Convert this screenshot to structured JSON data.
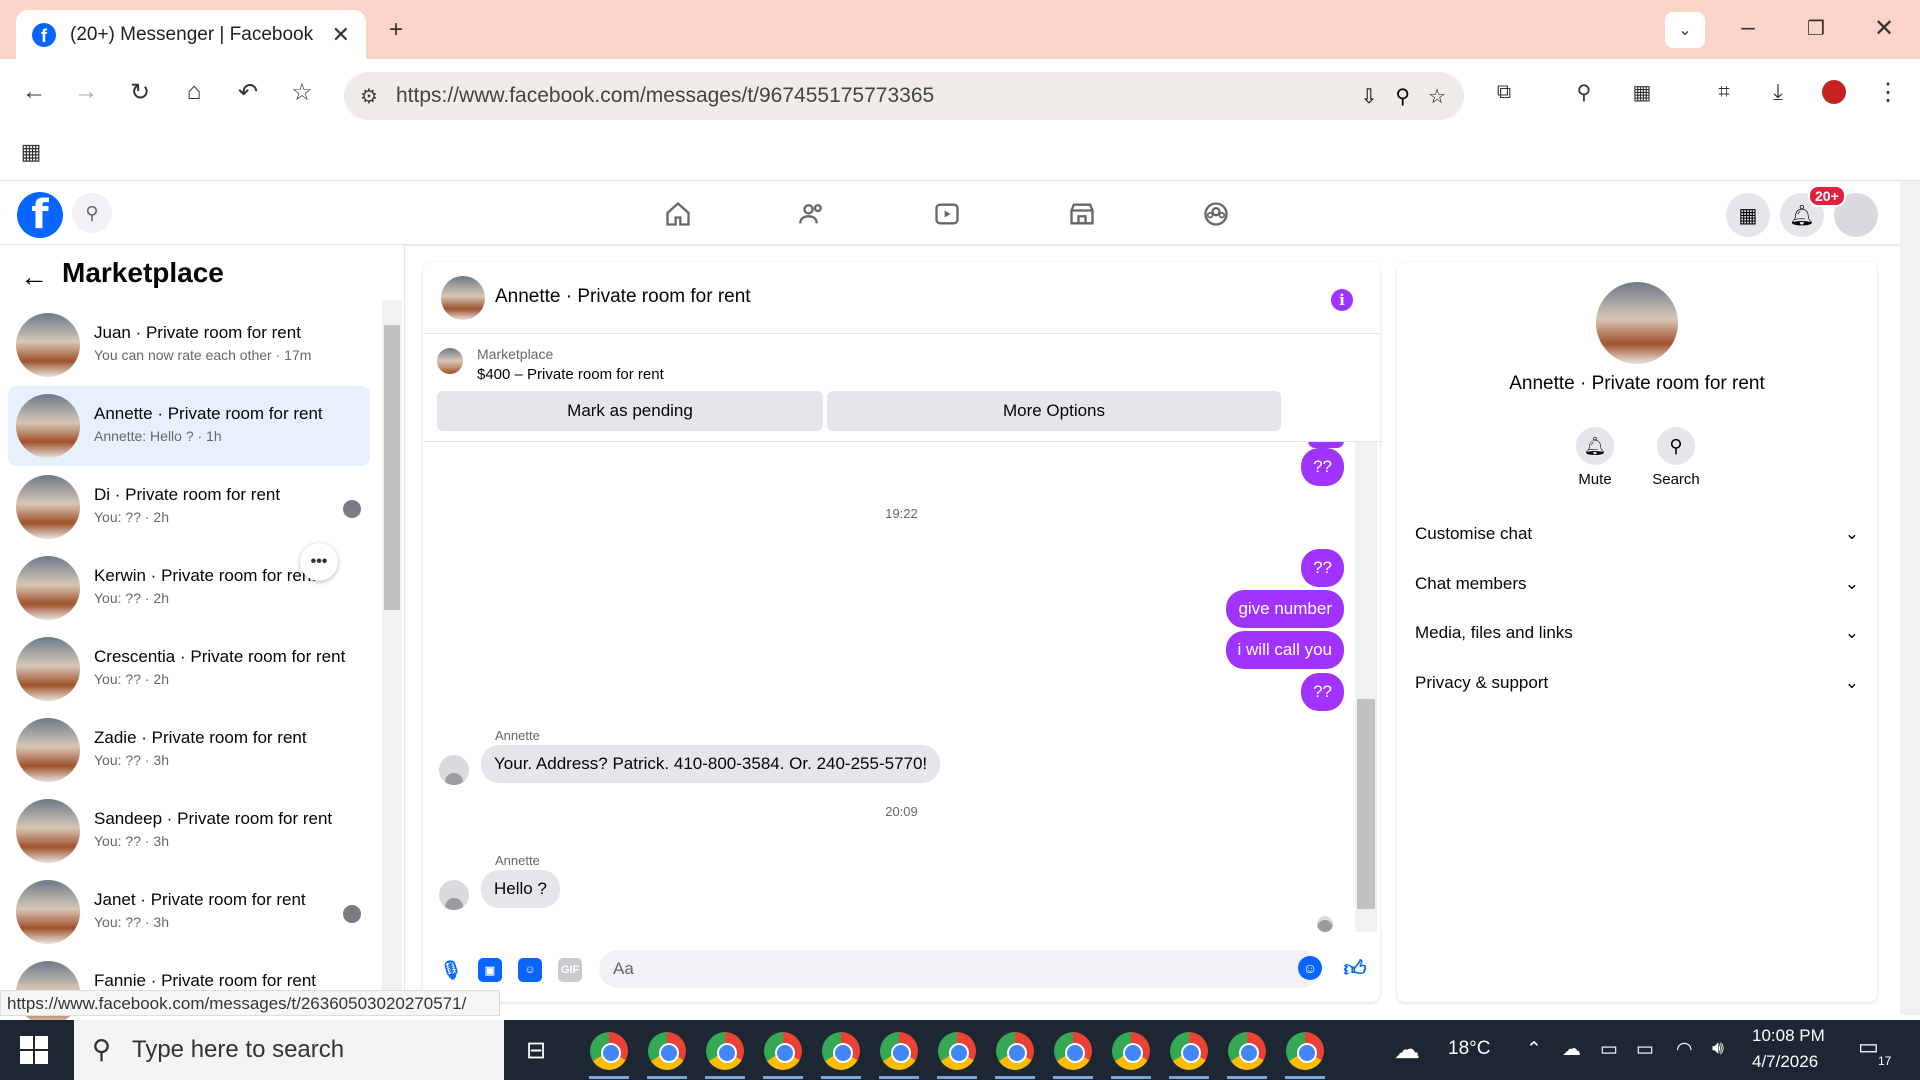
{
  "browser": {
    "tab_title": "(20+) Messenger | Facebook",
    "url": "https://www.facebook.com/messages/t/967455175773365"
  },
  "nav": {
    "notif_badge": "20+"
  },
  "left": {
    "title": "Marketplace",
    "conversations": [
      {
        "name": "Juan · Private room for rent",
        "snippet": "You can now rate each other · 17m"
      },
      {
        "name": "Annette · Private room for rent",
        "snippet": "Annette: Hello ? · 1h"
      },
      {
        "name": "Di · Private room for rent",
        "snippet": "You: ?? · 2h"
      },
      {
        "name": "Kerwin · Private room for rent",
        "snippet": "You: ?? · 2h"
      },
      {
        "name": "Crescentia · Private room for rent",
        "snippet": "You: ?? · 2h"
      },
      {
        "name": "Zadie · Private room for rent",
        "snippet": "You: ?? · 3h"
      },
      {
        "name": "Sandeep · Private room for rent",
        "snippet": "You: ?? · 3h"
      },
      {
        "name": "Janet · Private room for rent",
        "snippet": "You: ?? · 3h"
      },
      {
        "name": "Fannie · Private room for rent",
        "snippet": ""
      }
    ]
  },
  "chat": {
    "title": "Annette · Private room for rent",
    "marketplace_label": "Marketplace",
    "listing": "$400 – Private room for rent",
    "btn_pending": "Mark as pending",
    "btn_more": "More Options",
    "time1": "19:22",
    "out_msgs": [
      "??",
      "give number",
      "i will call you",
      "??"
    ],
    "top_msg": "??",
    "sender": "Annette",
    "in_msg1": "Your. Address?  Patrick. 410-800-3584. Or. 240-255-5770!",
    "time2": "20:09",
    "in_msg2": "Hello ?",
    "composer_placeholder": "Aa"
  },
  "right": {
    "name": "Annette · Private room for rent",
    "mute": "Mute",
    "search": "Search",
    "rows": [
      "Customise chat",
      "Chat members",
      "Media, files and links",
      "Privacy & support"
    ]
  },
  "status_url": "https://www.facebook.com/messages/t/26360503020270571/",
  "taskbar": {
    "search_placeholder": "Type here to search",
    "temp": "18°C",
    "time": "10:08 PM",
    "date": "4/7/2026",
    "notif_count": "17"
  }
}
